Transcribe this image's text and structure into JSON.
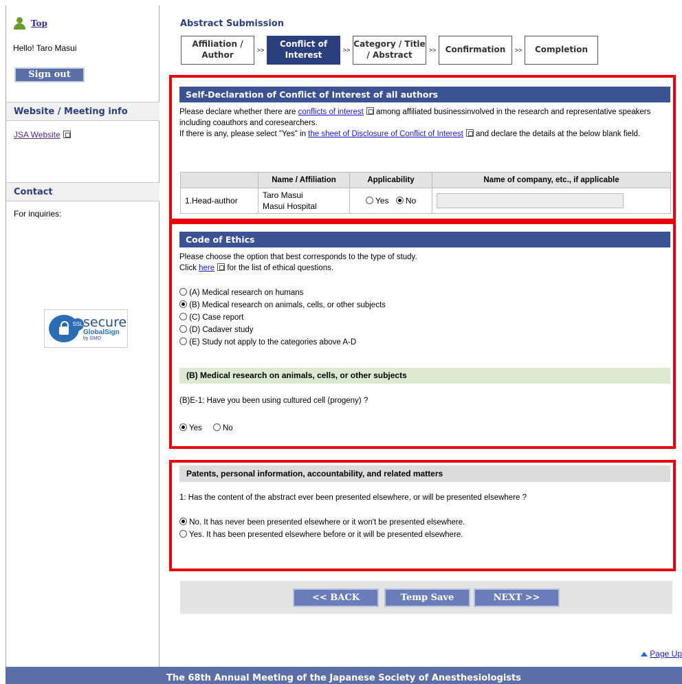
{
  "sidebar": {
    "top_link": "Top",
    "greeting": "Hello! Taro Masui",
    "signout_label": "Sign out",
    "website_heading": "Website / Meeting info",
    "website_link": "JSA Website",
    "contact_heading": "Contact",
    "contact_text": "For inquiries:",
    "ssl_badge": {
      "tag": "SSL",
      "secure": "secure",
      "brand": "GlobalSign",
      "sub": "by GMO"
    }
  },
  "header": {
    "title": "Abstract Submission",
    "steps": [
      {
        "label": "Affiliation / Author",
        "active": false
      },
      {
        "label": "Conflict of Interest",
        "active": true
      },
      {
        "label": "Category / Title / Abstract",
        "active": false
      },
      {
        "label": "Confirmation",
        "active": false
      },
      {
        "label": "Completion",
        "active": false
      }
    ],
    "step_separator": ">>"
  },
  "coi": {
    "heading": "Self-Declaration of Conflict of Interest of all authors",
    "text1_pre": "Please declare whether there are ",
    "text1_link": "conflicts of interest",
    "text1_post": " among affiliated businessinvolved in the research and representative speakers including coauthors and coresearchers.",
    "text2_pre": "If there is any, please select \"Yes\" in ",
    "text2_link": "the sheet of Disclosure of Conflict of Interest",
    "text2_post": " and declare the details at the below blank field.",
    "table": {
      "headers": [
        "",
        "Name / Affiliation",
        "Applicability",
        "Name of company, etc., if applicable"
      ],
      "row": {
        "role": "1.Head-author",
        "name": "Taro Masui",
        "affiliation": "Masui Hospital",
        "yes_label": "Yes",
        "no_label": "No",
        "selected": "No",
        "company_value": ""
      }
    }
  },
  "ethics": {
    "heading": "Code of Ethics",
    "text1": "Please choose the option that best corresponds to the type of study.",
    "text2_pre": "Click ",
    "text2_link": "here",
    "text2_post": " for the list of ethical questions.",
    "options": [
      {
        "label": "(A) Medical research on humans",
        "selected": false
      },
      {
        "label": "(B) Medical research on animals, cells, or other subjects",
        "selected": true
      },
      {
        "label": "(C) Case report",
        "selected": false
      },
      {
        "label": "(D) Cadaver study",
        "selected": false
      },
      {
        "label": "(E) Study not apply to the categories above A-D",
        "selected": false
      }
    ],
    "sub_heading": "(B) Medical research on animals, cells, or other subjects",
    "question": "(B)E-1: Have you been using cultured cell (progeny) ?",
    "q_yes": "Yes",
    "q_no": "No",
    "q_selected": "Yes"
  },
  "patents": {
    "heading": "Patents, personal information, accountability, and related matters",
    "question": "1: Has the content of the abstract ever been presented elsewhere, or will be presented elsewhere ?",
    "options": [
      {
        "label": "No. It has never been presented elsewhere or it won't be presented elsewhere.",
        "selected": true
      },
      {
        "label": "Yes. It has been presented elsewhere before or it will be presented elsewhere.",
        "selected": false
      }
    ]
  },
  "buttons": {
    "back": "<< BACK",
    "temp_save": "Temp Save",
    "next": "NEXT >>"
  },
  "page_up": "Page Up",
  "footer": "The 68th Annual Meeting of the Japanese Society of Anesthesiologists",
  "colors": {
    "primary": "#3b5293",
    "button": "#6b7db8",
    "highlight_border": "#e8000b",
    "green_bar": "#dde9d1"
  }
}
